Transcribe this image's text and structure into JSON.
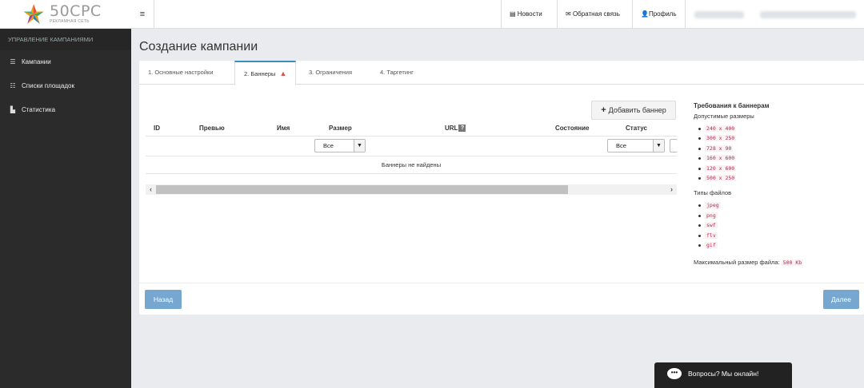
{
  "logo": {
    "name": "50CPC",
    "tagline": "РЕКЛАМНАЯ СЕТЬ"
  },
  "sidebar": {
    "heading": "УПРАВЛЕНИЕ КАМПАНИЯМИ",
    "items": [
      {
        "label": "Кампании",
        "icon": "list-icon"
      },
      {
        "label": "Списки площадок",
        "icon": "list-ul-icon"
      },
      {
        "label": "Статистика",
        "icon": "bar-chart-icon"
      }
    ]
  },
  "topbar": {
    "menu_icon": "≡",
    "news": "Новости",
    "feedback": "Обратная связь",
    "profile": "Профиль"
  },
  "page": {
    "title": "Создание кампании"
  },
  "tabs": [
    {
      "label": "1. Основные настройки"
    },
    {
      "label": "2. Баннеры",
      "warning": "▲"
    },
    {
      "label": "3. Ограничения"
    },
    {
      "label": "4. Таргетинг"
    }
  ],
  "banners": {
    "add_button": "Добавить баннер",
    "columns": [
      "ID",
      "Превью",
      "Имя",
      "Размер",
      "URL",
      "Состояние",
      "Статус"
    ],
    "url_help": "?",
    "size_filter": "Все",
    "status_filter": "Все",
    "empty_message": "Баннеры не найдены"
  },
  "requirements": {
    "title": "Требования к баннерам",
    "sizes_label": "Допустимые размеры",
    "sizes": [
      "240 x 400",
      "300 x 250",
      "728 x 90",
      "160 x 600",
      "120 x 600",
      "500 x 250"
    ],
    "types_label": "Типы файлов",
    "types": [
      "jpeg",
      "png",
      "swf",
      "flv",
      "gif"
    ],
    "max_size_label": "Максимальный размер файла:",
    "max_size_value": "500 Kb"
  },
  "footer": {
    "back": "Назад",
    "next": "Далее"
  },
  "chat": {
    "label": "Вопросы? Мы онлайн!"
  },
  "colors": {
    "primary": "#3c8dbc",
    "button": "#75a7d0",
    "sidebar": "#2b2b2b",
    "code": "#c7254e",
    "warning": "#d9534f"
  }
}
